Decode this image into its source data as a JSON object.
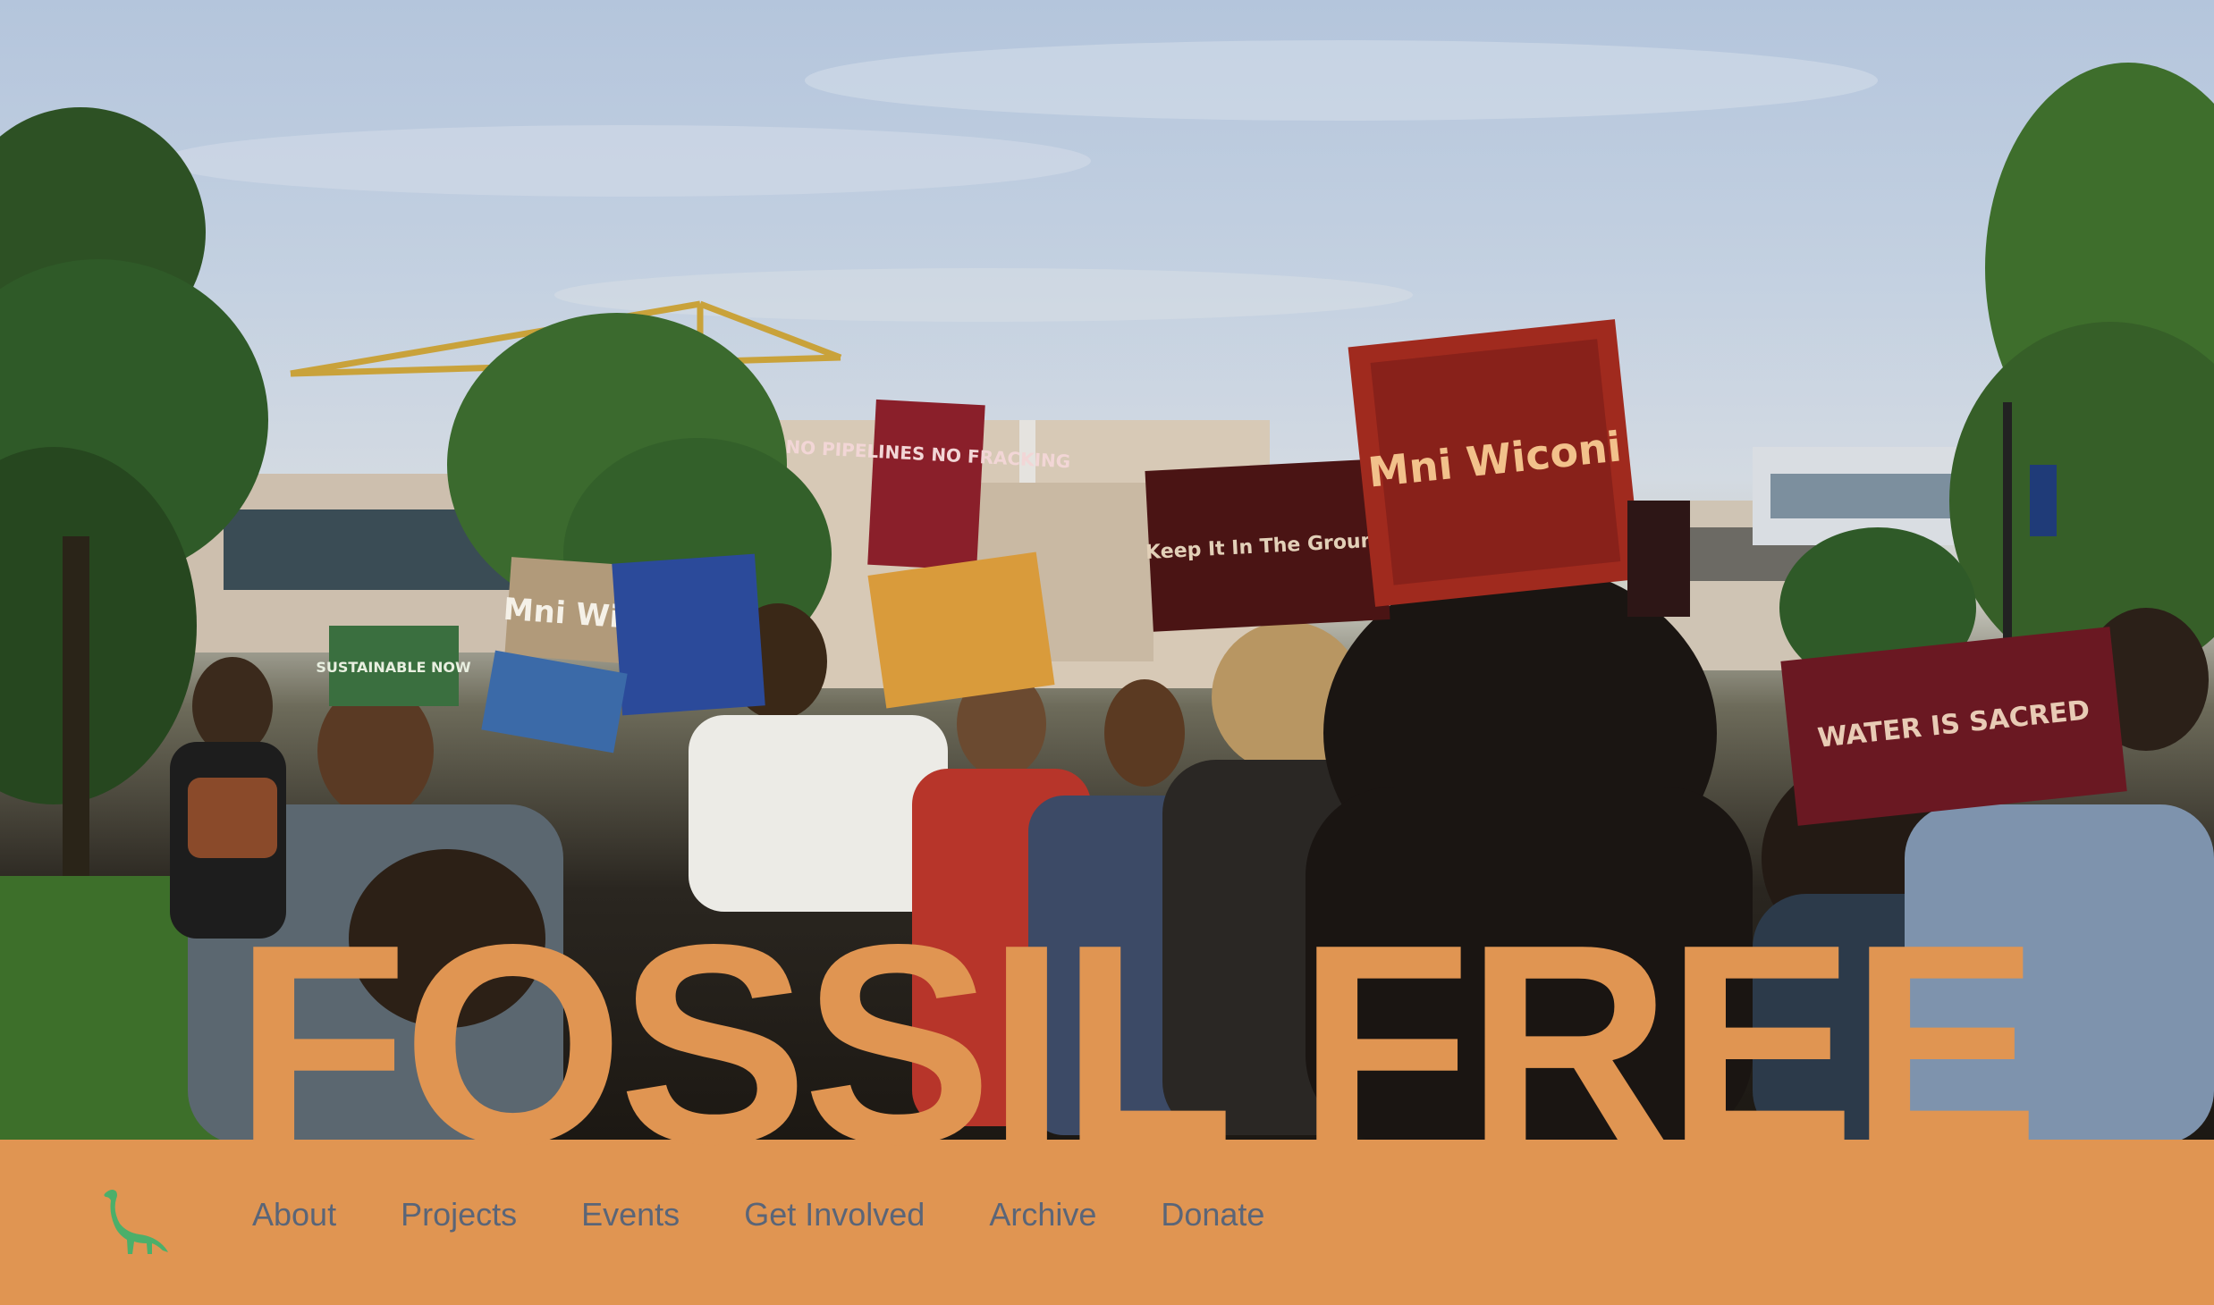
{
  "hero": {
    "headline": "FOSSIL FREE",
    "signs": {
      "sign1": "NO PIPELINES NO FRACKING",
      "sign2": "Mni Wiconi",
      "sign3": "Keep It In The Ground",
      "sign4": "Mni Wiconi",
      "sign5": "WATER IS SACRED",
      "sign6": "SUSTAINABLE NOW"
    }
  },
  "nav": {
    "logo_icon": "dinosaur-icon",
    "items": [
      {
        "label": "About"
      },
      {
        "label": "Projects"
      },
      {
        "label": "Events"
      },
      {
        "label": "Get Involved"
      },
      {
        "label": "Archive"
      },
      {
        "label": "Donate"
      }
    ]
  },
  "colors": {
    "accent": "#e09552",
    "nav_text": "#5a6578",
    "logo": "#4caf6a"
  }
}
